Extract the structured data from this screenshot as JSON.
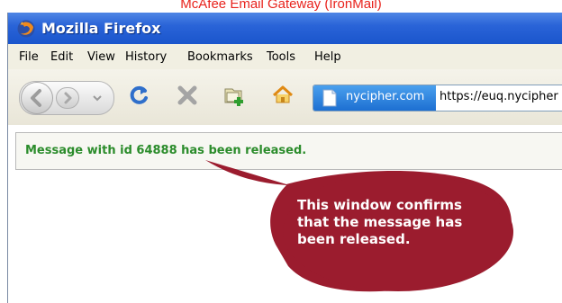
{
  "document_header": "McAfee Email Gateway (IronMail)",
  "window": {
    "title": "Mozilla Firefox"
  },
  "menu": [
    {
      "label": "File"
    },
    {
      "label": "Edit"
    },
    {
      "label": "View"
    },
    {
      "label": "History"
    },
    {
      "label": "Bookmarks"
    },
    {
      "label": "Tools"
    },
    {
      "label": "Help"
    }
  ],
  "toolbar": {
    "icons": [
      "back-icon",
      "forward-icon",
      "reload-icon",
      "stop-icon",
      "new-tab-icon",
      "home-icon"
    ],
    "site_identity": "nycipher.com",
    "url": "https://euq.nycipher"
  },
  "content": {
    "message": "Message with id 64888 has been released."
  },
  "callout": {
    "lines": [
      "This window confirms",
      "that the message has",
      "been released."
    ],
    "color": "#9b1c2e"
  },
  "colors": {
    "titlebar": "#2a64d8",
    "message_text": "#2b8c2b",
    "header_text": "#e8231d"
  }
}
